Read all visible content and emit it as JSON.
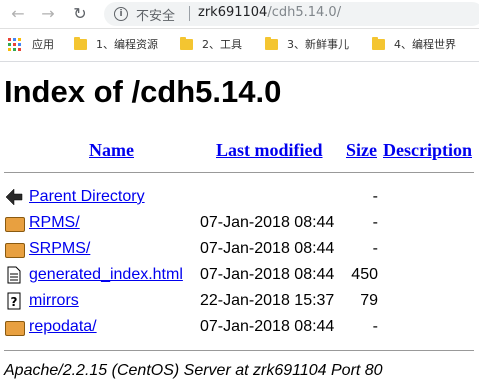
{
  "browser": {
    "security_label": "不安全",
    "url_host": "zrk691104",
    "url_path": "/cdh5.14.0/"
  },
  "bookmarks": {
    "apps_label": "应用",
    "items": [
      {
        "label": "1、编程资源"
      },
      {
        "label": "2、工具"
      },
      {
        "label": "3、新鲜事儿"
      },
      {
        "label": "4、编程世界"
      }
    ]
  },
  "page": {
    "title": "Index of /cdh5.14.0",
    "columns": {
      "name": "Name",
      "last_modified": "Last modified",
      "size": "Size",
      "description": "Description"
    },
    "rows": [
      {
        "name": "Parent Directory",
        "modified": "",
        "size": "-",
        "icon": "back-arrow-icon"
      },
      {
        "name": "RPMS/",
        "modified": "07-Jan-2018 08:44",
        "size": "-",
        "icon": "folder-icon"
      },
      {
        "name": "SRPMS/",
        "modified": "07-Jan-2018 08:44",
        "size": "-",
        "icon": "folder-icon"
      },
      {
        "name": "generated_index.html",
        "modified": "07-Jan-2018 08:44",
        "size": "450",
        "icon": "document-icon"
      },
      {
        "name": "mirrors",
        "modified": "22-Jan-2018 15:37",
        "size": "79",
        "icon": "unknown-file-icon"
      },
      {
        "name": "repodata/",
        "modified": "07-Jan-2018 08:44",
        "size": "-",
        "icon": "folder-icon"
      }
    ],
    "footer": "Apache/2.2.15 (CentOS) Server at zrk691104 Port 80"
  }
}
